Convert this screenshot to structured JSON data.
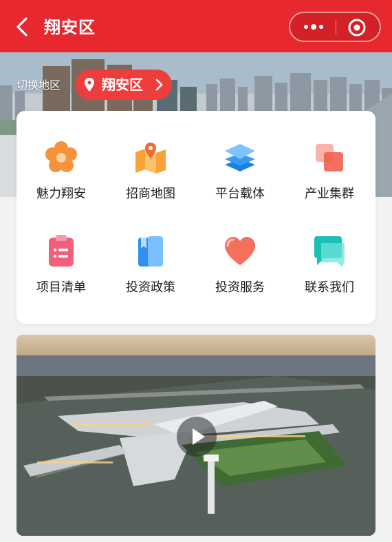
{
  "header": {
    "title": "翔安区",
    "bg_color": "#e8282f"
  },
  "banner": {
    "switch_label": "切换地区",
    "district": "翔安区",
    "pill_color": "#ee3d3d"
  },
  "menu": {
    "items": [
      {
        "label": "魅力翔安",
        "icon": "flower-icon"
      },
      {
        "label": "招商地图",
        "icon": "map-icon"
      },
      {
        "label": "平台载体",
        "icon": "layers-icon"
      },
      {
        "label": "产业集群",
        "icon": "cluster-icon"
      },
      {
        "label": "项目清单",
        "icon": "clipboard-icon"
      },
      {
        "label": "投资政策",
        "icon": "book-icon"
      },
      {
        "label": "投资服务",
        "icon": "heart-icon"
      },
      {
        "label": "联系我们",
        "icon": "chat-icon"
      }
    ]
  },
  "media": {
    "icon": "play-icon"
  }
}
